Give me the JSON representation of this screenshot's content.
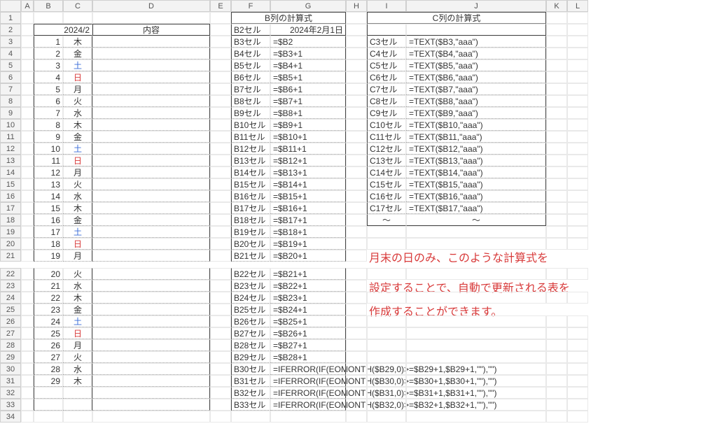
{
  "columns": [
    "A",
    "B",
    "C",
    "D",
    "E",
    "F",
    "G",
    "H",
    "I",
    "J",
    "K",
    "L"
  ],
  "header_month": "2024/2",
  "header_content": "内容",
  "header_B_formula": "B列の計算式",
  "header_C_formula": "C列の計算式",
  "B2_label": "B2セル",
  "B2_value": "2024年2月1日",
  "days": [
    {
      "n": "1",
      "wd": "木",
      "cls": ""
    },
    {
      "n": "2",
      "wd": "金",
      "cls": ""
    },
    {
      "n": "3",
      "wd": "土",
      "cls": "sat"
    },
    {
      "n": "4",
      "wd": "日",
      "cls": "sun"
    },
    {
      "n": "5",
      "wd": "月",
      "cls": ""
    },
    {
      "n": "6",
      "wd": "火",
      "cls": ""
    },
    {
      "n": "7",
      "wd": "水",
      "cls": ""
    },
    {
      "n": "8",
      "wd": "木",
      "cls": ""
    },
    {
      "n": "9",
      "wd": "金",
      "cls": ""
    },
    {
      "n": "10",
      "wd": "土",
      "cls": "sat"
    },
    {
      "n": "11",
      "wd": "日",
      "cls": "sun"
    },
    {
      "n": "12",
      "wd": "月",
      "cls": ""
    },
    {
      "n": "13",
      "wd": "火",
      "cls": ""
    },
    {
      "n": "14",
      "wd": "水",
      "cls": ""
    },
    {
      "n": "15",
      "wd": "木",
      "cls": ""
    },
    {
      "n": "16",
      "wd": "金",
      "cls": ""
    },
    {
      "n": "17",
      "wd": "土",
      "cls": "sat"
    },
    {
      "n": "18",
      "wd": "日",
      "cls": "sun"
    },
    {
      "n": "19",
      "wd": "月",
      "cls": ""
    },
    {
      "n": "20",
      "wd": "火",
      "cls": ""
    },
    {
      "n": "21",
      "wd": "水",
      "cls": ""
    },
    {
      "n": "22",
      "wd": "木",
      "cls": ""
    },
    {
      "n": "23",
      "wd": "金",
      "cls": ""
    },
    {
      "n": "24",
      "wd": "土",
      "cls": "sat"
    },
    {
      "n": "25",
      "wd": "日",
      "cls": "sun"
    },
    {
      "n": "26",
      "wd": "月",
      "cls": ""
    },
    {
      "n": "27",
      "wd": "火",
      "cls": ""
    },
    {
      "n": "28",
      "wd": "水",
      "cls": ""
    },
    {
      "n": "29",
      "wd": "木",
      "cls": ""
    }
  ],
  "b_formulas": [
    {
      "cell": "B3セル",
      "f": "=$B2"
    },
    {
      "cell": "B4セル",
      "f": "=$B3+1"
    },
    {
      "cell": "B5セル",
      "f": "=$B4+1"
    },
    {
      "cell": "B6セル",
      "f": "=$B5+1"
    },
    {
      "cell": "B7セル",
      "f": "=$B6+1"
    },
    {
      "cell": "B8セル",
      "f": "=$B7+1"
    },
    {
      "cell": "B9セル",
      "f": "=$B8+1"
    },
    {
      "cell": "B10セル",
      "f": "=$B9+1"
    },
    {
      "cell": "B11セル",
      "f": "=$B10+1"
    },
    {
      "cell": "B12セル",
      "f": "=$B11+1"
    },
    {
      "cell": "B13セル",
      "f": "=$B12+1"
    },
    {
      "cell": "B14セル",
      "f": "=$B13+1"
    },
    {
      "cell": "B15セル",
      "f": "=$B14+1"
    },
    {
      "cell": "B16セル",
      "f": "=$B15+1"
    },
    {
      "cell": "B17セル",
      "f": "=$B16+1"
    },
    {
      "cell": "B18セル",
      "f": "=$B17+1"
    },
    {
      "cell": "B19セル",
      "f": "=$B18+1"
    },
    {
      "cell": "B20セル",
      "f": "=$B19+1"
    },
    {
      "cell": "B21セル",
      "f": "=$B20+1"
    },
    {
      "cell": "B22セル",
      "f": "=$B21+1"
    },
    {
      "cell": "B23セル",
      "f": "=$B22+1"
    },
    {
      "cell": "B24セル",
      "f": "=$B23+1"
    },
    {
      "cell": "B25セル",
      "f": "=$B24+1"
    },
    {
      "cell": "B26セル",
      "f": "=$B25+1"
    },
    {
      "cell": "B27セル",
      "f": "=$B26+1"
    },
    {
      "cell": "B28セル",
      "f": "=$B27+1"
    },
    {
      "cell": "B29セル",
      "f": "=$B28+1"
    },
    {
      "cell": "B30セル",
      "f": "=IFERROR(IF(EOMONTH($B29,0)>=$B29+1,$B29+1,\"\"),\"\")"
    },
    {
      "cell": "B31セル",
      "f": "=IFERROR(IF(EOMONTH($B30,0)>=$B30+1,$B30+1,\"\"),\"\")"
    },
    {
      "cell": "B32セル",
      "f": "=IFERROR(IF(EOMONTH($B31,0)>=$B31+1,$B31+1,\"\"),\"\")"
    },
    {
      "cell": "B33セル",
      "f": "=IFERROR(IF(EOMONTH($B32,0)>=$B32+1,$B32+1,\"\"),\"\")"
    }
  ],
  "c_formulas": [
    {
      "cell": "C3セル",
      "f": "=TEXT($B3,\"aaa\")"
    },
    {
      "cell": "C4セル",
      "f": "=TEXT($B4,\"aaa\")"
    },
    {
      "cell": "C5セル",
      "f": "=TEXT($B5,\"aaa\")"
    },
    {
      "cell": "C6セル",
      "f": "=TEXT($B6,\"aaa\")"
    },
    {
      "cell": "C7セル",
      "f": "=TEXT($B7,\"aaa\")"
    },
    {
      "cell": "C8セル",
      "f": "=TEXT($B8,\"aaa\")"
    },
    {
      "cell": "C9セル",
      "f": "=TEXT($B9,\"aaa\")"
    },
    {
      "cell": "C10セル",
      "f": "=TEXT($B10,\"aaa\")"
    },
    {
      "cell": "C11セル",
      "f": "=TEXT($B11,\"aaa\")"
    },
    {
      "cell": "C12セル",
      "f": "=TEXT($B12,\"aaa\")"
    },
    {
      "cell": "C13セル",
      "f": "=TEXT($B13,\"aaa\")"
    },
    {
      "cell": "C14セル",
      "f": "=TEXT($B14,\"aaa\")"
    },
    {
      "cell": "C15セル",
      "f": "=TEXT($B15,\"aaa\")"
    },
    {
      "cell": "C16セル",
      "f": "=TEXT($B16,\"aaa\")"
    },
    {
      "cell": "C17セル",
      "f": "=TEXT($B17,\"aaa\")"
    }
  ],
  "c_tilde": {
    "cell": "〜",
    "f": "〜"
  },
  "annotation": {
    "l1": "月末の日のみ、このような計算式を",
    "l2": "設定することで、自動で更新される表を",
    "l3": "作成することができます。"
  },
  "last_row": 34
}
